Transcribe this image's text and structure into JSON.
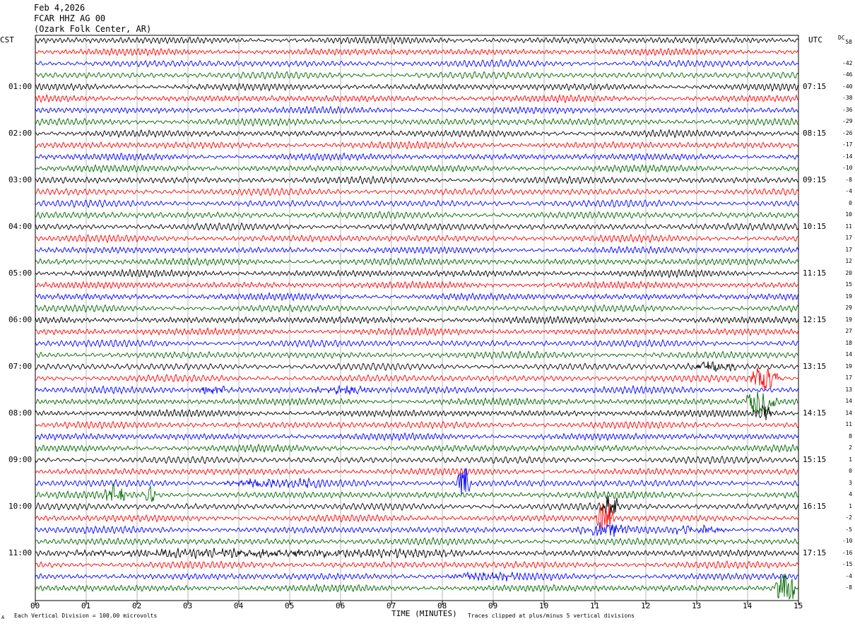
{
  "header": {
    "date": "Feb 4,2026",
    "station": "FCAR HHZ AG 00",
    "location": "(Ozark Folk Center, AR)"
  },
  "labels": {
    "left_tz": "CST",
    "right_tz": "UTC",
    "dc_label": "DC",
    "x_title": "TIME (MINUTES)",
    "scale_note": "Each Vertical Division =  100.00 microvolts",
    "clip_note": "Traces clipped at plus/minus 5 vertical divisions",
    "corner_mark": "A"
  },
  "colors": {
    "black": "#000000",
    "red": "#ff0000",
    "blue": "#0000ff",
    "green": "#006600",
    "grid": "#999999"
  },
  "chart_data": {
    "type": "line",
    "title": "Feb 4,2026",
    "xlabel": "TIME (MINUTES)",
    "xlim": [
      0,
      15
    ],
    "x_ticks": [
      "00",
      "01",
      "02",
      "03",
      "04",
      "05",
      "06",
      "07",
      "08",
      "09",
      "10",
      "11",
      "12",
      "13",
      "14",
      "15"
    ],
    "trace_minutes": 15,
    "trace_count": 48,
    "trace_color_cycle": [
      "black",
      "red",
      "blue",
      "green"
    ],
    "left_hour_labels": [
      "01:00",
      "02:00",
      "03:00",
      "04:00",
      "05:00",
      "06:00",
      "07:00",
      "08:00",
      "09:00",
      "10:00",
      "11:00"
    ],
    "right_hour_labels": [
      "07:15",
      "08:15",
      "09:15",
      "10:15",
      "11:15",
      "12:15",
      "13:15",
      "14:15",
      "15:15",
      "16:15",
      "17:15"
    ],
    "dc_offsets": [
      "58",
      "-42",
      "-46",
      "-40",
      "-38",
      "-36",
      "-29",
      "-26",
      "-17",
      "-14",
      "-10",
      "-8",
      "-4",
      "0",
      "10",
      "11",
      "17",
      "17",
      "12",
      "20",
      "15",
      "19",
      "29",
      "19",
      "27",
      "18",
      "14",
      "19",
      "17",
      "13",
      "14",
      "14",
      "11",
      "8",
      "2",
      "1",
      "0",
      "3",
      "4",
      "1",
      "-2",
      "-5",
      "-10",
      "-16",
      "-15",
      "-4",
      "-8"
    ],
    "events": [
      {
        "trace": 30,
        "start_min": 3.1,
        "end_min": 3.9,
        "amplitude": 0.8
      },
      {
        "trace": 30,
        "start_min": 5.2,
        "end_min": 6.8,
        "amplitude": 0.6
      },
      {
        "trace": 28,
        "start_min": 12.8,
        "end_min": 13.9,
        "amplitude": 0.9
      },
      {
        "trace": 29,
        "start_min": 14.0,
        "end_min": 14.7,
        "amplitude": 2.4
      },
      {
        "trace": 31,
        "start_min": 13.9,
        "end_min": 14.6,
        "amplitude": 3.0
      },
      {
        "trace": 32,
        "start_min": 14.1,
        "end_min": 14.5,
        "amplitude": 1.6
      },
      {
        "trace": 38,
        "start_min": 8.25,
        "end_min": 8.6,
        "amplitude": 3.2
      },
      {
        "trace": 38,
        "start_min": 3.5,
        "end_min": 6.0,
        "amplitude": 0.7
      },
      {
        "trace": 39,
        "start_min": 1.3,
        "end_min": 1.8,
        "amplitude": 1.6
      },
      {
        "trace": 39,
        "start_min": 2.1,
        "end_min": 2.4,
        "amplitude": 1.6
      },
      {
        "trace": 40,
        "start_min": 11.1,
        "end_min": 11.5,
        "amplitude": 2.6
      },
      {
        "trace": 42,
        "start_min": 10.5,
        "end_min": 11.9,
        "amplitude": 1.0
      },
      {
        "trace": 42,
        "start_min": 12.3,
        "end_min": 13.8,
        "amplitude": 0.6
      },
      {
        "trace": 41,
        "start_min": 11.0,
        "end_min": 11.4,
        "amplitude": 3.5
      },
      {
        "trace": 44,
        "start_min": 0.0,
        "end_min": 9.4,
        "amplitude": 0.6
      },
      {
        "trace": 46,
        "start_min": 7.8,
        "end_min": 10.0,
        "amplitude": 0.6
      },
      {
        "trace": 47,
        "start_min": 14.5,
        "end_min": 15.0,
        "amplitude": 3.0
      }
    ]
  }
}
